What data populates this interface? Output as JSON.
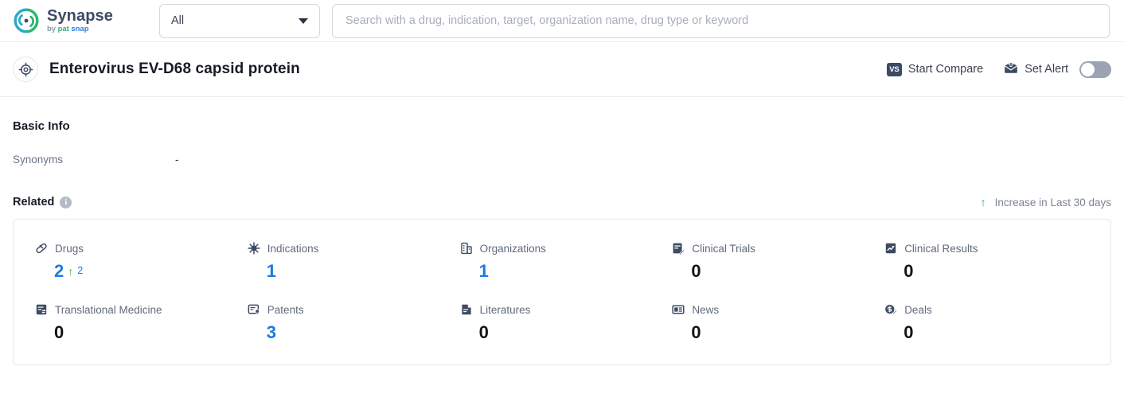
{
  "brand": {
    "name": "Synapse",
    "by": "by",
    "sub_pat": "pat",
    "sub_snap": "snap",
    "logo_icon": "synapse-logo-icon",
    "accent_green": "#2bb673",
    "accent_blue": "#2e7fe0"
  },
  "search": {
    "scope_value": "All",
    "placeholder": "Search with a drug, indication, target, organization name, drug type or keyword",
    "value": "",
    "caret_icon": "chevron-down-icon"
  },
  "entity": {
    "icon": "target-icon",
    "title": "Enterovirus EV-D68 capsid protein",
    "actions": {
      "compare_label": "Start Compare",
      "compare_icon": "vs-icon",
      "compare_badge_text": "VS",
      "alert_label": "Set Alert",
      "alert_icon": "alert-mail-icon",
      "alert_toggle_state": "off"
    }
  },
  "basic_info": {
    "title": "Basic Info",
    "rows": [
      {
        "label": "Synonyms",
        "value": "-"
      }
    ]
  },
  "related": {
    "title": "Related",
    "info_icon": "info-icon",
    "info_glyph": "i",
    "legend": {
      "arrow_icon": "arrow-up-icon",
      "arrow_glyph": "↑",
      "text": "Increase in Last 30 days",
      "color": "#3ba94b"
    },
    "stats": [
      {
        "label": "Drugs",
        "icon": "pill-icon",
        "value": "2",
        "value_color": "#1f7ae0",
        "delta": "2",
        "delta_arrow": "↑"
      },
      {
        "label": "Indications",
        "icon": "virus-icon",
        "value": "1",
        "value_color": "#1f7ae0",
        "delta": "",
        "delta_arrow": ""
      },
      {
        "label": "Organizations",
        "icon": "building-icon",
        "value": "1",
        "value_color": "#1f7ae0",
        "delta": "",
        "delta_arrow": ""
      },
      {
        "label": "Clinical Trials",
        "icon": "clipboard-pen-icon",
        "value": "0",
        "value_color": "#111418",
        "delta": "",
        "delta_arrow": ""
      },
      {
        "label": "Clinical Results",
        "icon": "document-chart-icon",
        "value": "0",
        "value_color": "#111418",
        "delta": "",
        "delta_arrow": ""
      },
      {
        "label": "Translational Medicine",
        "icon": "document-swap-icon",
        "value": "0",
        "value_color": "#111418",
        "delta": "",
        "delta_arrow": ""
      },
      {
        "label": "Patents",
        "icon": "patent-seal-icon",
        "value": "3",
        "value_color": "#1f7ae0",
        "delta": "",
        "delta_arrow": ""
      },
      {
        "label": "Literatures",
        "icon": "literature-icon",
        "value": "0",
        "value_color": "#111418",
        "delta": "",
        "delta_arrow": ""
      },
      {
        "label": "News",
        "icon": "newspaper-icon",
        "value": "0",
        "value_color": "#111418",
        "delta": "",
        "delta_arrow": ""
      },
      {
        "label": "Deals",
        "icon": "deal-coin-icon",
        "value": "0",
        "value_color": "#111418",
        "delta": "",
        "delta_arrow": ""
      }
    ]
  }
}
